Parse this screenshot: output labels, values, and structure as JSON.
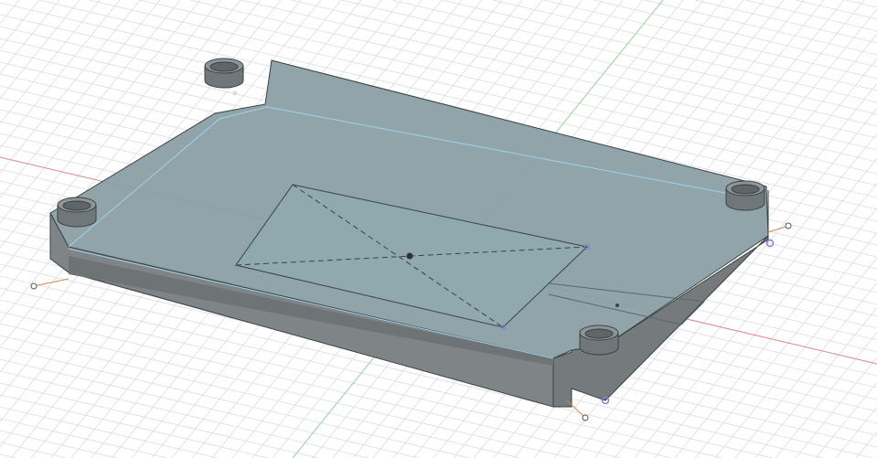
{
  "viewport": {
    "background": "#ffffff",
    "grid_color": "#d9dcdf",
    "x_axis_color": "#e08a8a",
    "y_axis_color": "#9bd49b"
  },
  "model": {
    "top_face_color": "#8b9fa4",
    "side_face_color": "#7f8587",
    "edge_color": "#3b4144",
    "highlight_edge_color": "#9fd3ea",
    "point_color": "#8a7ad0",
    "feet_count": 4
  }
}
